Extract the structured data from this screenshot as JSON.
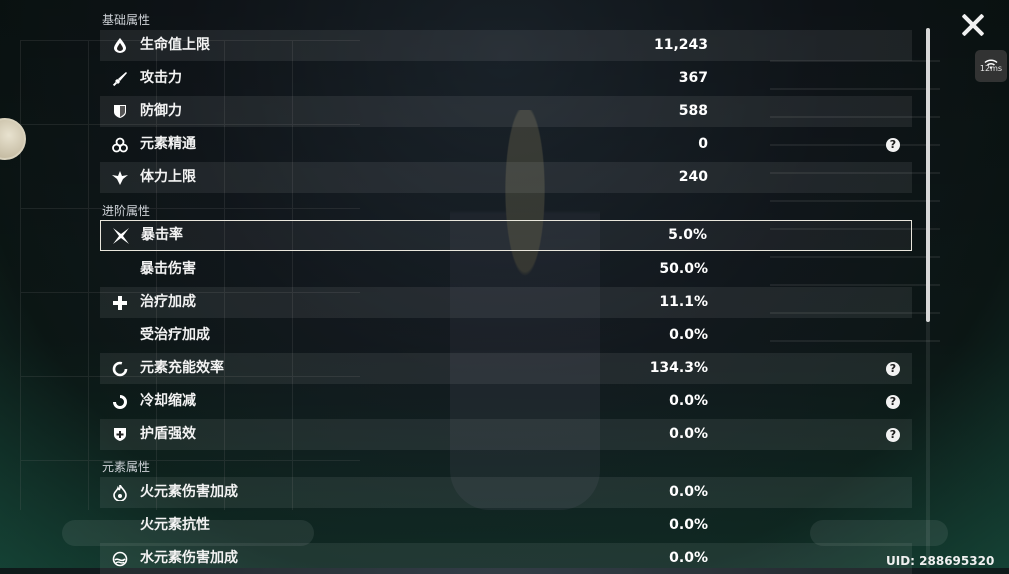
{
  "close_button": {
    "icon": "close-icon"
  },
  "network": {
    "latency": "12ms",
    "icon": "wifi-icon"
  },
  "uid": "UID: 288695320",
  "sections": {
    "basic": {
      "title": "基础属性"
    },
    "advanced": {
      "title": "进阶属性"
    },
    "elemental": {
      "title": "元素属性"
    }
  },
  "stats": [
    {
      "label": "生命值上限",
      "value": "11,243",
      "icon": "hp-drop-icon"
    },
    {
      "label": "攻击力",
      "value": "367",
      "icon": "attack-sword-icon"
    },
    {
      "label": "防御力",
      "value": "588",
      "icon": "defense-shield-icon"
    },
    {
      "label": "元素精通",
      "value": "0",
      "icon": "elemental-mastery-icon",
      "help": "?"
    },
    {
      "label": "体力上限",
      "value": "240",
      "icon": "stamina-icon"
    },
    {
      "label": "暴击率",
      "value": "5.0%",
      "icon": "crit-rate-icon"
    },
    {
      "label": "暴击伤害",
      "value": "50.0%"
    },
    {
      "label": "治疗加成",
      "value": "11.1%",
      "icon": "healing-cross-icon"
    },
    {
      "label": "受治疗加成",
      "value": "0.0%"
    },
    {
      "label": "元素充能效率",
      "value": "134.3%",
      "icon": "energy-recharge-icon",
      "help": "?"
    },
    {
      "label": "冷却缩减",
      "value": "0.0%",
      "icon": "cd-reduction-icon",
      "help": "?"
    },
    {
      "label": "护盾强效",
      "value": "0.0%",
      "icon": "shield-strength-icon",
      "help": "?"
    },
    {
      "label": "火元素伤害加成",
      "value": "0.0%",
      "icon": "pyro-icon"
    },
    {
      "label": "火元素抗性",
      "value": "0.0%"
    },
    {
      "label": "水元素伤害加成",
      "value": "0.0%",
      "icon": "hydro-icon"
    }
  ],
  "colors": {
    "highlight_border": "#e9e6dc",
    "row_alt": "rgba(255,255,255,0.075)"
  }
}
